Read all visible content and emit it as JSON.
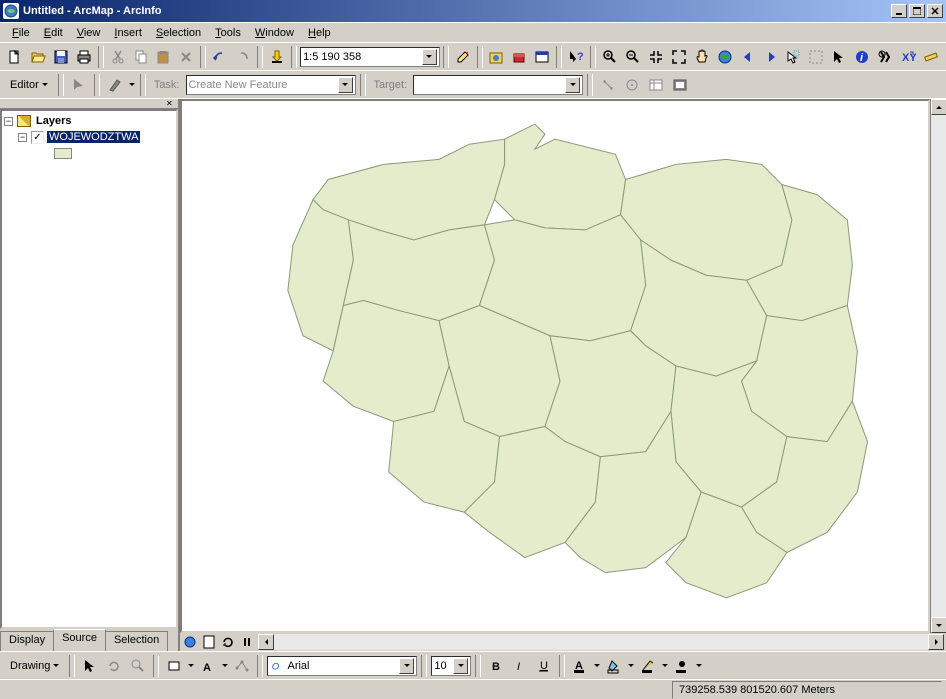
{
  "title": "Untitled - ArcMap - ArcInfo",
  "menu": [
    "File",
    "Edit",
    "View",
    "Insert",
    "Selection",
    "Tools",
    "Window",
    "Help"
  ],
  "scale": "1:5 190 358",
  "editor": {
    "label": "Editor",
    "task_label": "Task:",
    "task_value": "Create New Feature",
    "target_label": "Target:",
    "target_value": ""
  },
  "toc": {
    "root": "Layers",
    "layer_name": "WOJEWODZTWA",
    "layer_checked": true,
    "tabs": [
      "Display",
      "Source",
      "Selection"
    ],
    "active_tab": "Source"
  },
  "drawing": {
    "label": "Drawing",
    "font": "Arial",
    "font_size": "10"
  },
  "status": {
    "coords": "739258.539 801520.607 Meters"
  }
}
